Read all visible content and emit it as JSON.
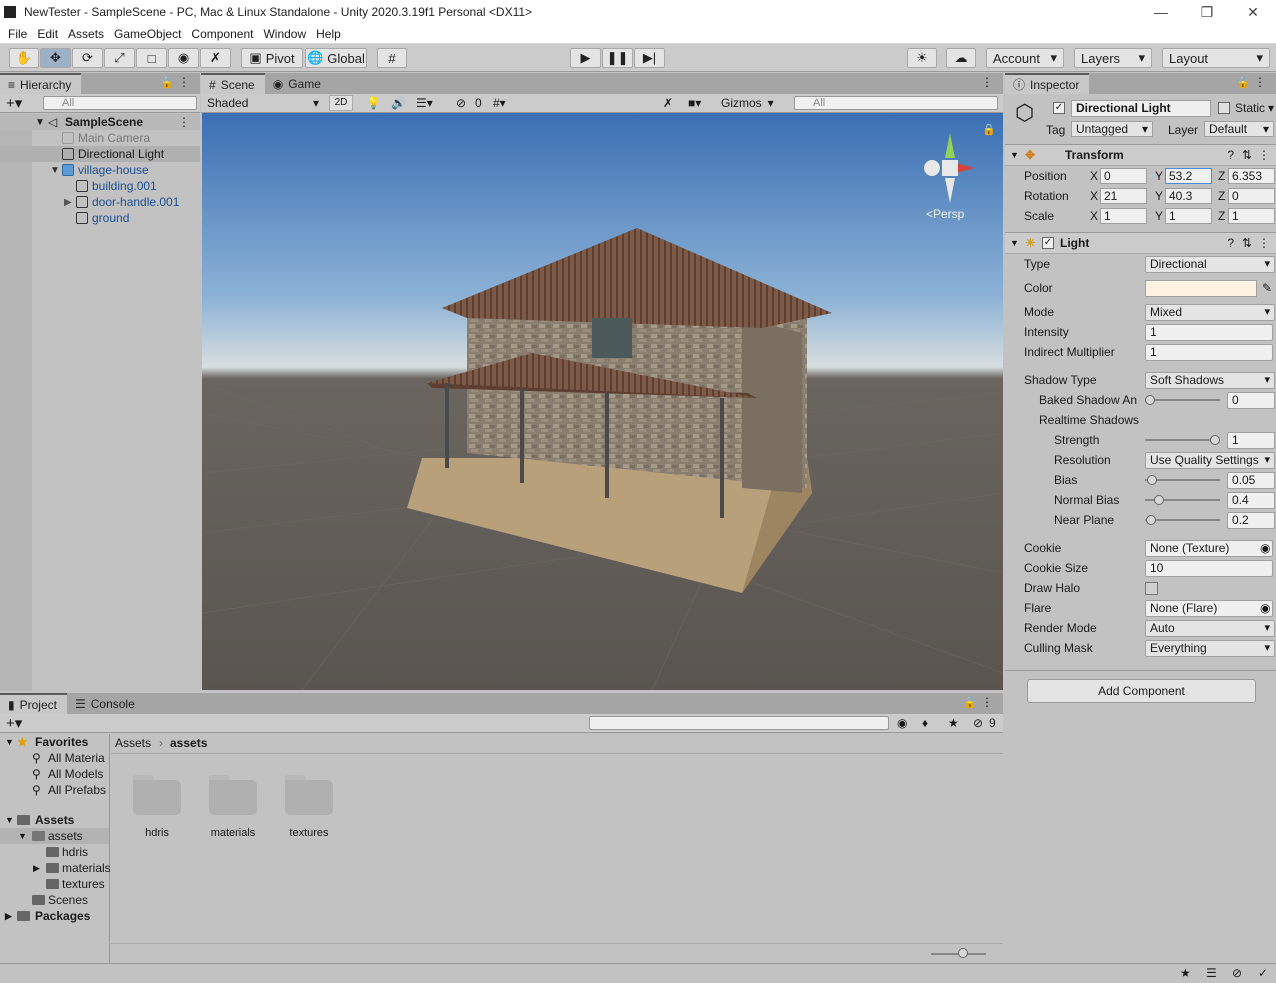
{
  "window": {
    "title": "NewTester - SampleScene - PC, Mac & Linux Standalone - Unity 2020.3.19f1 Personal <DX11>"
  },
  "menu": [
    "File",
    "Edit",
    "Assets",
    "GameObject",
    "Component",
    "Window",
    "Help"
  ],
  "toolbar": {
    "pivot": "Pivot",
    "global": "Global",
    "account": "Account",
    "layers": "Layers",
    "layout": "Layout"
  },
  "hierarchy": {
    "tab": "Hierarchy",
    "search_placeholder": "All",
    "items": [
      {
        "label": "SampleScene"
      },
      {
        "label": "Main Camera"
      },
      {
        "label": "Directional Light"
      },
      {
        "label": "village-house"
      },
      {
        "label": "building.001"
      },
      {
        "label": "door-handle.001"
      },
      {
        "label": "ground"
      }
    ]
  },
  "scene": {
    "tab_scene": "Scene",
    "tab_game": "Game",
    "shading": "Shaded",
    "mode2d": "2D",
    "hidden_count": "0",
    "gizmos": "Gizmos",
    "search_placeholder": "All",
    "persp": "<Persp",
    "axis_x": "x",
    "axis_y": "y",
    "axis_z": "z"
  },
  "inspector": {
    "tab": "Inspector",
    "object_name": "Directional Light",
    "static_label": "Static",
    "tag_label": "Tag",
    "tag_value": "Untagged",
    "layer_label": "Layer",
    "layer_value": "Default",
    "transform": {
      "title": "Transform",
      "position_label": "Position",
      "rotation_label": "Rotation",
      "scale_label": "Scale",
      "pos": {
        "x": "0",
        "y": "53.2",
        "z": "6.353"
      },
      "rot": {
        "x": "21",
        "y": "40.3",
        "z": "0"
      },
      "scale": {
        "x": "1",
        "y": "1",
        "z": "1"
      },
      "x": "X",
      "y": "Y",
      "z": "Z"
    },
    "light": {
      "title": "Light",
      "type_label": "Type",
      "type_value": "Directional",
      "color_label": "Color",
      "color_value": "#fef3e3",
      "mode_label": "Mode",
      "mode_value": "Mixed",
      "intensity_label": "Intensity",
      "intensity_value": "1",
      "indirect_label": "Indirect Multiplier",
      "indirect_value": "1",
      "shadow_type_label": "Shadow Type",
      "shadow_type_value": "Soft Shadows",
      "baked_label": "Baked Shadow An",
      "baked_value": "0",
      "realtime_label": "Realtime Shadows",
      "strength_label": "Strength",
      "strength_value": "1",
      "resolution_label": "Resolution",
      "resolution_value": "Use Quality Settings",
      "bias_label": "Bias",
      "bias_value": "0.05",
      "normal_bias_label": "Normal Bias",
      "normal_bias_value": "0.4",
      "near_plane_label": "Near Plane",
      "near_plane_value": "0.2",
      "cookie_label": "Cookie",
      "cookie_value": "None (Texture)",
      "cookie_size_label": "Cookie Size",
      "cookie_size_value": "10",
      "halo_label": "Draw Halo",
      "flare_label": "Flare",
      "flare_value": "None (Flare)",
      "render_mode_label": "Render Mode",
      "render_mode_value": "Auto",
      "culling_label": "Culling Mask",
      "culling_value": "Everything"
    },
    "add_component": "Add Component"
  },
  "project": {
    "tab_project": "Project",
    "tab_console": "Console",
    "hidden_count": "9",
    "favorites": "Favorites",
    "fav_items": [
      "All Materia",
      "All Models",
      "All Prefabs"
    ],
    "assets_root": "Assets",
    "tree": [
      "assets",
      "hdris",
      "materials",
      "textures",
      "Scenes"
    ],
    "packages": "Packages",
    "breadcrumb": [
      "Assets",
      "assets"
    ],
    "folders": [
      "hdris",
      "materials",
      "textures"
    ]
  }
}
